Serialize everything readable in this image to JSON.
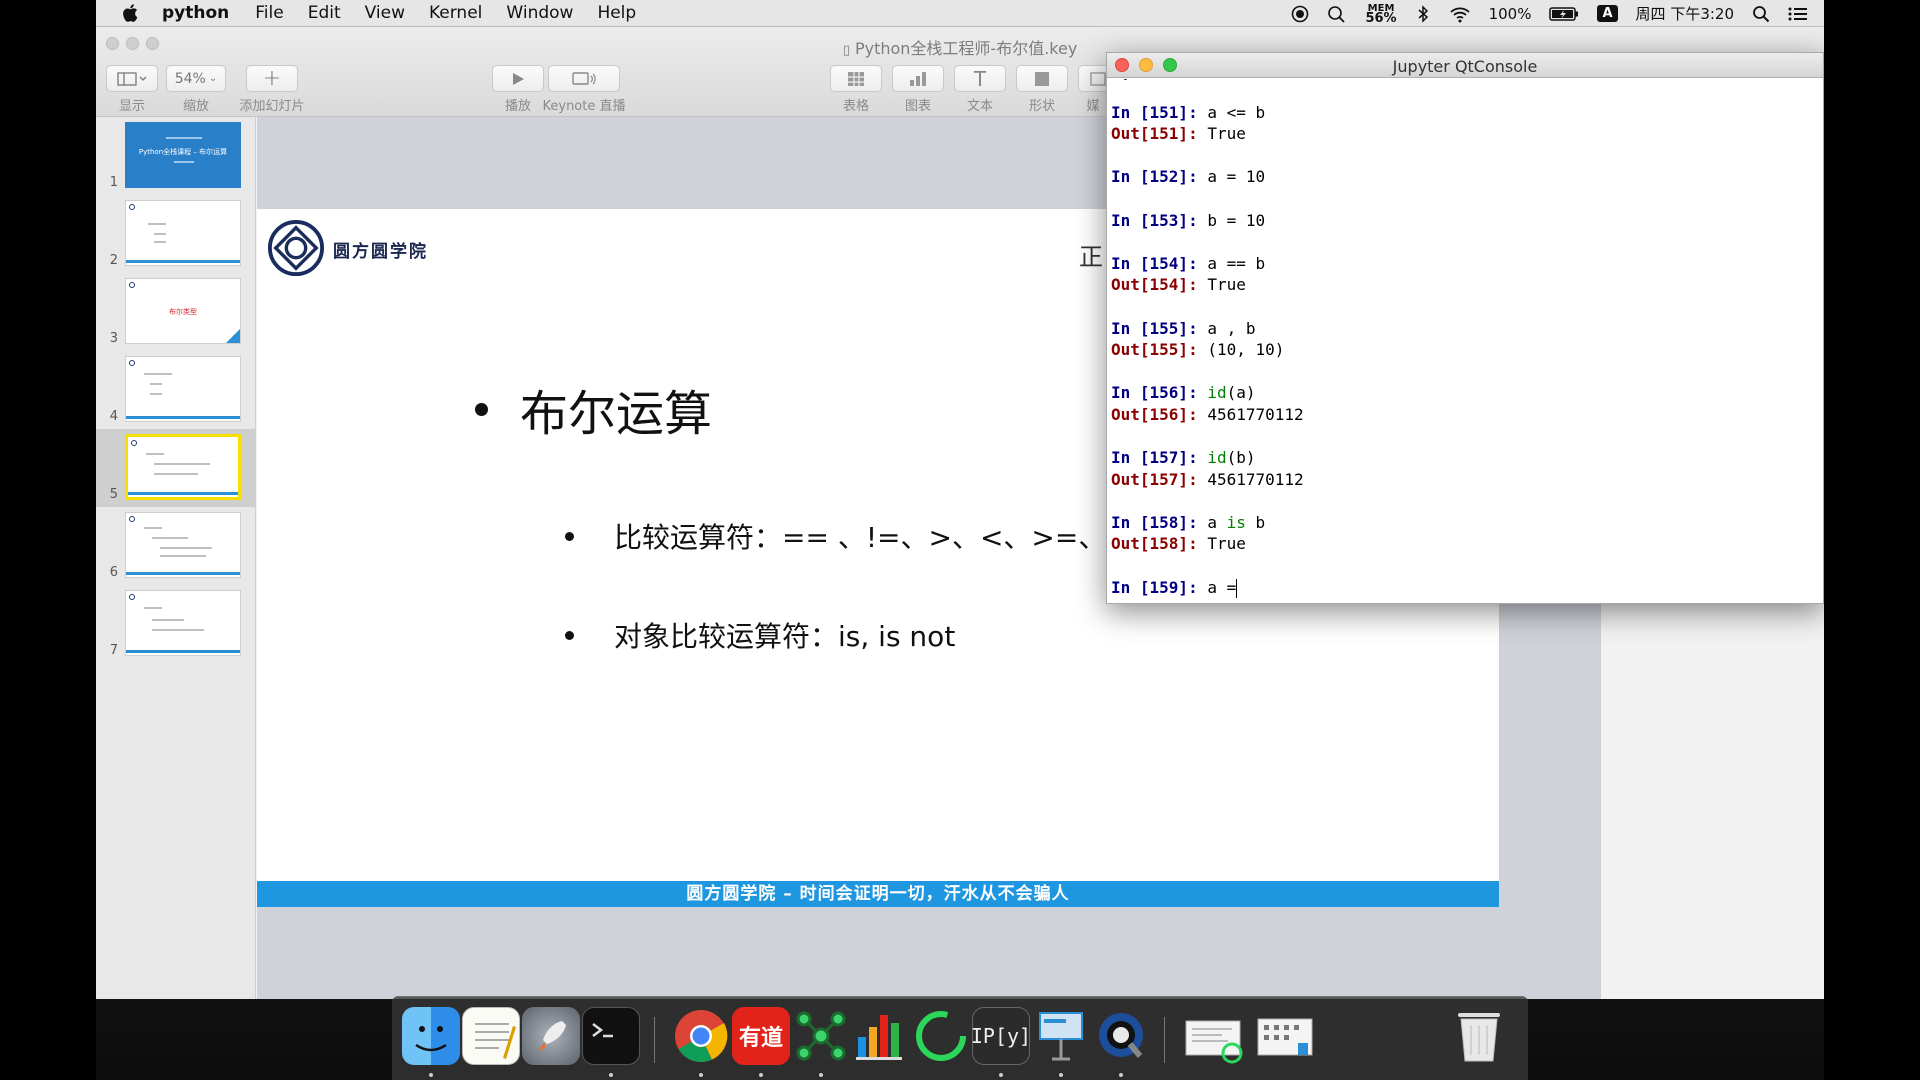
{
  "menubar": {
    "app_name": "python",
    "menus": [
      "File",
      "Edit",
      "View",
      "Kernel",
      "Window",
      "Help"
    ],
    "mem_label": "MEM",
    "mem_value": "56%",
    "battery": "100%",
    "input_method": "A",
    "clock": "周四 下午3:20"
  },
  "keynote": {
    "window_title": "Python全栈工程师-布尔值.key",
    "toolbar": {
      "view_label": "显示",
      "zoom_value": "54%",
      "zoom_label": "缩放",
      "add_slide_label": "添加幻灯片",
      "play_label": "播放",
      "keynote_live_label": "Keynote 直播",
      "table_label": "表格",
      "chart_label": "图表",
      "text_label": "文本",
      "shape_label": "形状",
      "media_label": "媒"
    },
    "slide_numbers": [
      "1",
      "2",
      "3",
      "4",
      "5",
      "6",
      "7"
    ],
    "thumb1_title": "Python全栈课程 – 布尔运算",
    "thumb3_title": "布尔类型",
    "slide": {
      "logo_text": "圆方圆学院",
      "corner_char": "正",
      "bullet_main": "布尔运算",
      "bullet_sub1": "比较运算符：== 、!=、>、<、>=、<=",
      "bullet_sub2": "对象比较运算符：is, is not",
      "footer": "圆方圆学院 – 时间会证明一切，汗水从不会骗人"
    }
  },
  "jupyter": {
    "title": "Jupyter QtConsole",
    "prompt_partial_top": "-.-",
    "cells": [
      {
        "in": "In [151]: ",
        "code": "a <= b",
        "out": "Out[151]: ",
        "result": "True"
      },
      {
        "in": "In [152]: ",
        "code": "a = 10"
      },
      {
        "in": "In [153]: ",
        "code": "b = 10"
      },
      {
        "in": "In [154]: ",
        "code": "a == b",
        "out": "Out[154]: ",
        "result": "True"
      },
      {
        "in": "In [155]: ",
        "code": "a , b",
        "out": "Out[155]: ",
        "result": "(10, 10)"
      },
      {
        "in": "In [156]: ",
        "code_fn": "id",
        "code_arg": "(a)",
        "out": "Out[156]: ",
        "result": "4561770112"
      },
      {
        "in": "In [157]: ",
        "code_fn": "id",
        "code_arg": "(b)",
        "out": "Out[157]: ",
        "result": "4561770112"
      },
      {
        "in": "In [158]: ",
        "code_a": "a ",
        "code_kw": "is",
        "code_b": " b",
        "out": "Out[158]: ",
        "result": "True"
      }
    ],
    "current_prompt": "In [159]: ",
    "current_input": "a =",
    "colors": {
      "in_prompt": "#000080",
      "out_prompt": "#8b0000",
      "keyword": "#008000"
    }
  },
  "dock": {
    "apps": [
      "finder-icon",
      "textedit-icon",
      "launchpad-icon",
      "terminal-icon",
      "chrome-icon",
      "youdao-icon",
      "xmind-icon",
      "numbers-icon",
      "activity-icon",
      "ipython-icon",
      "keynote-icon",
      "quicktime-icon",
      "stack1-icon",
      "stack2-icon",
      "trash-icon"
    ],
    "youdao_text": "有道",
    "ipython_text": "IP[y]"
  }
}
